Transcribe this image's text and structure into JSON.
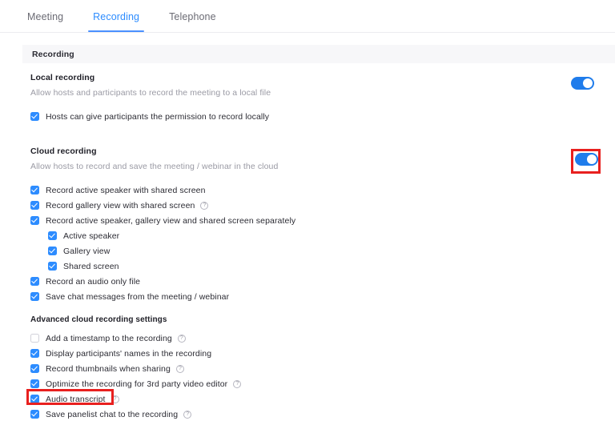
{
  "tabs": [
    {
      "label": "Meeting",
      "active": false
    },
    {
      "label": "Recording",
      "active": true
    },
    {
      "label": "Telephone",
      "active": false
    }
  ],
  "section": {
    "title": "Recording"
  },
  "colors": {
    "accent_blue": "#2d8cff",
    "toggle_on": "#1f7ceb",
    "highlight_red": "#e8201f",
    "section_bar_bg": "#f7f7f9",
    "text_primary": "#2b2b33",
    "text_muted": "#9a9aa4"
  },
  "local_recording": {
    "title": "Local recording",
    "description": "Allow hosts and participants to record the meeting to a local file",
    "toggle_state": "on",
    "options": [
      {
        "label": "Hosts can give participants the permission to record locally",
        "checked": true,
        "help": false
      }
    ]
  },
  "cloud_recording": {
    "title": "Cloud recording",
    "description": "Allow hosts to record and save the meeting / webinar in the cloud",
    "toggle_state": "on",
    "toggle_highlighted": true,
    "options": [
      {
        "label": "Record active speaker with shared screen",
        "checked": true,
        "help": false,
        "indent": false
      },
      {
        "label": "Record gallery view with shared screen",
        "checked": true,
        "help": true,
        "indent": false
      },
      {
        "label": "Record active speaker, gallery view and shared screen separately",
        "checked": true,
        "help": false,
        "indent": false
      },
      {
        "label": "Active speaker",
        "checked": true,
        "help": false,
        "indent": true
      },
      {
        "label": "Gallery view",
        "checked": true,
        "help": false,
        "indent": true
      },
      {
        "label": "Shared screen",
        "checked": true,
        "help": false,
        "indent": true
      },
      {
        "label": "Record an audio only file",
        "checked": true,
        "help": false,
        "indent": false
      },
      {
        "label": "Save chat messages from the meeting / webinar",
        "checked": true,
        "help": false,
        "indent": false
      }
    ],
    "advanced": {
      "title": "Advanced cloud recording settings",
      "options": [
        {
          "label": "Add a timestamp to the recording",
          "checked": false,
          "help": true,
          "highlighted": false
        },
        {
          "label": "Display participants' names in the recording",
          "checked": true,
          "help": false,
          "highlighted": false
        },
        {
          "label": "Record thumbnails when sharing",
          "checked": true,
          "help": true,
          "highlighted": false
        },
        {
          "label": "Optimize the recording for 3rd party video editor",
          "checked": true,
          "help": true,
          "highlighted": false
        },
        {
          "label": "Audio transcript",
          "checked": true,
          "help": true,
          "highlighted": true
        },
        {
          "label": "Save panelist chat to the recording",
          "checked": true,
          "help": true,
          "highlighted": false
        }
      ]
    }
  },
  "icons": {
    "help": "?"
  }
}
